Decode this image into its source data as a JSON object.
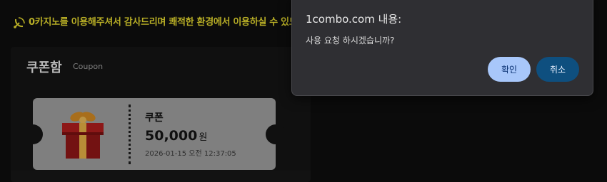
{
  "notice": {
    "text": "0카지노를 이용해주셔서 감사드리며 쾌적한 환경에서 이용하실 수 있도록",
    "icon": "satellite-dish-icon"
  },
  "coupon_section": {
    "title": "쿠폰함",
    "subtitle": "Coupon"
  },
  "coupon": {
    "name": "쿠폰",
    "amount": "50,000",
    "unit": "원",
    "date": "2026-01-15 오전 12:37:05",
    "icon": "gift-box-icon"
  },
  "dialog": {
    "title": "1combo.com 내용:",
    "message": "사용 요청 하시겠습니까?",
    "ok_label": "확인",
    "cancel_label": "취소"
  },
  "colors": {
    "notice_text": "#c9be2a",
    "ok_button": "#a8c7fa",
    "cancel_button": "#0e4f7f",
    "dialog_bg": "#2f2f33"
  }
}
